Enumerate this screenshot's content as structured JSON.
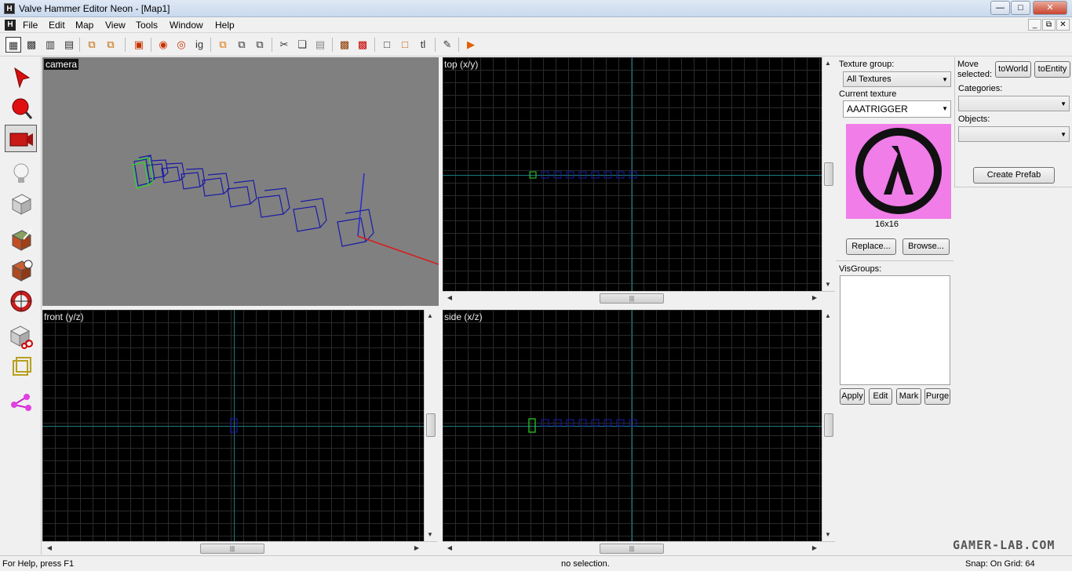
{
  "window": {
    "title": "Valve Hammer Editor Neon - [Map1]",
    "app_icon": "H"
  },
  "menu": [
    "File",
    "Edit",
    "Map",
    "View",
    "Tools",
    "Window",
    "Help"
  ],
  "toolbar": {
    "text_tool": "tl"
  },
  "viewports": {
    "camera": "camera",
    "top": "top (x/y)",
    "front": "front (y/z)",
    "side": "side (x/z)"
  },
  "texture_panel": {
    "group_label": "Texture group:",
    "group_value": "All Textures",
    "current_label": "Current texture",
    "current_value": "AAATRIGGER",
    "size": "16x16",
    "replace_button": "Replace...",
    "browse_button": "Browse..."
  },
  "visgroups": {
    "label": "VisGroups:",
    "apply": "Apply",
    "edit": "Edit",
    "mark": "Mark",
    "purge": "Purge"
  },
  "prefab_panel": {
    "move_label": "Move selected:",
    "to_world": "toWorld",
    "to_entity": "toEntity",
    "categories_label": "Categories:",
    "objects_label": "Objects:",
    "create_prefab": "Create Prefab"
  },
  "status": {
    "help": "For Help, press F1",
    "selection": "no selection.",
    "snap": "Snap: On Grid: 64"
  },
  "watermark": "GAMER-LAB.COM",
  "colors": {
    "brush": "#1a1aa8",
    "selected_brush": "#2ad62a",
    "texture_pink": "#f07de8",
    "axis": "#1d7a7a"
  }
}
